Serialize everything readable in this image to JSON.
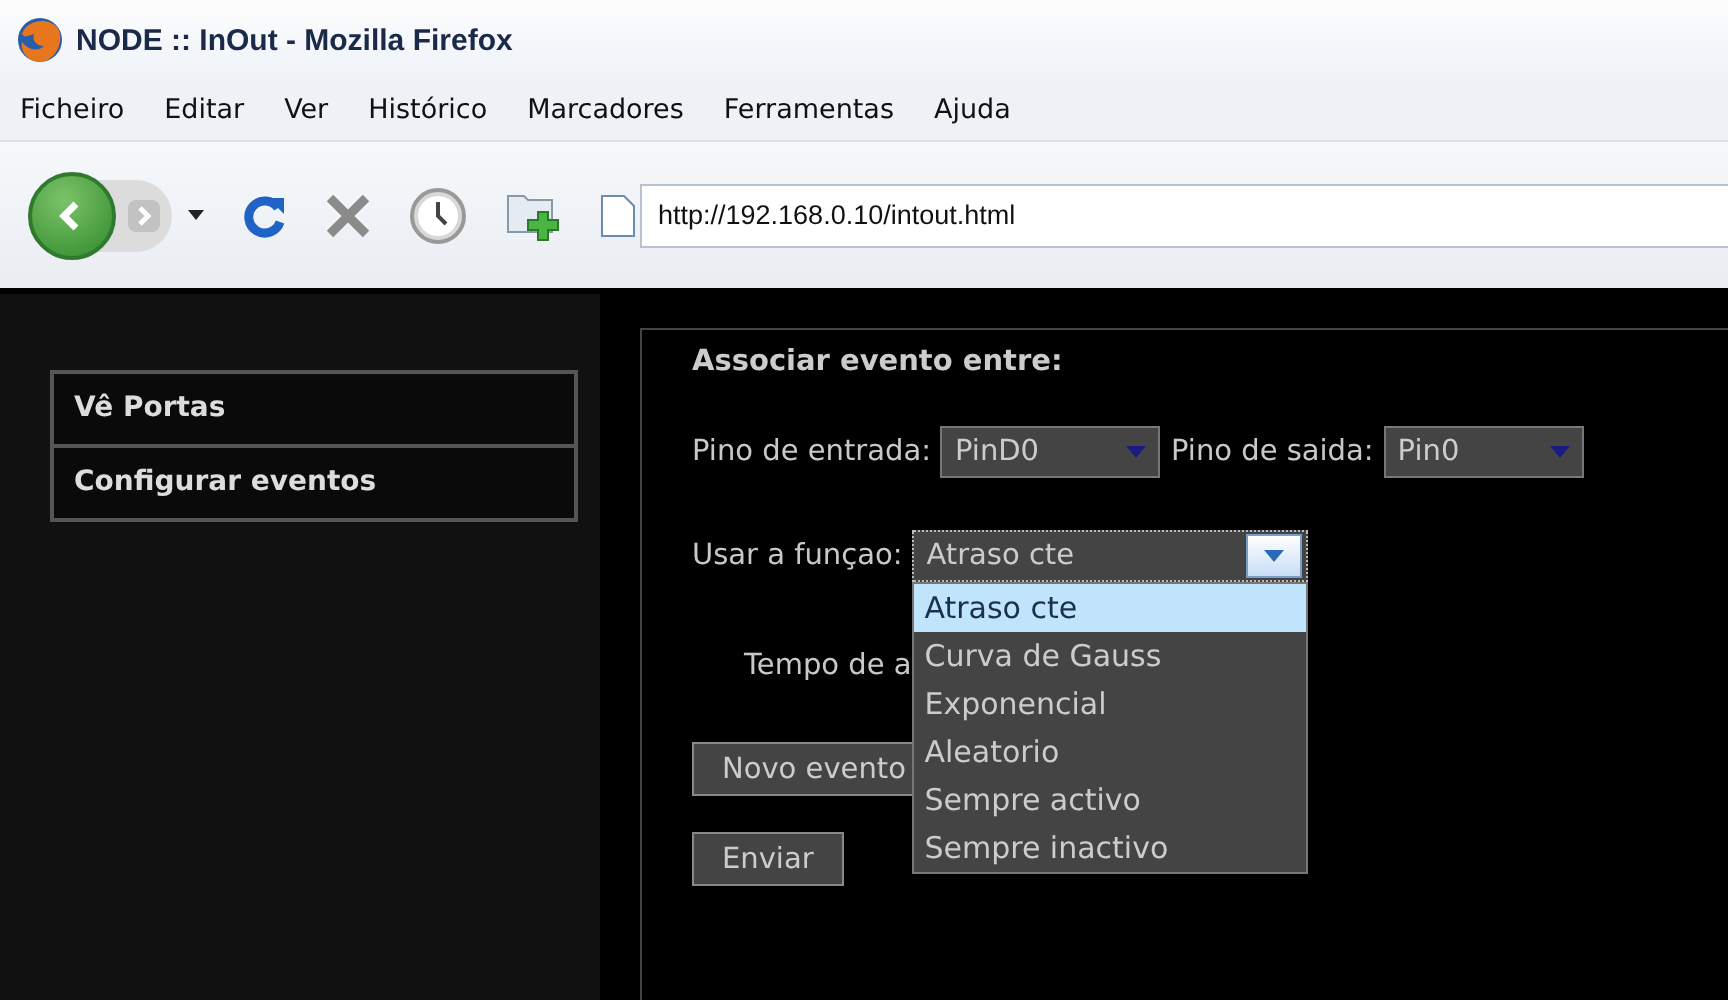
{
  "window": {
    "title": "NODE :: InOut - Mozilla Firefox"
  },
  "menu_bar": [
    "Ficheiro",
    "Editar",
    "Ver",
    "Histórico",
    "Marcadores",
    "Ferramentas",
    "Ajuda"
  ],
  "toolbar": {
    "address": "http://192.168.0.10/intout.html"
  },
  "sidebar": {
    "items": [
      "Vê Portas",
      "Configurar eventos"
    ]
  },
  "form": {
    "heading": "Associar evento entre:",
    "input_pin": {
      "label": "Pino de entrada:",
      "value": "PinD0"
    },
    "output_pin": {
      "label": "Pino de saida:",
      "value": "Pin0"
    },
    "function": {
      "label": "Usar a funçao:",
      "value": "Atraso cte",
      "expanded": true,
      "options": [
        {
          "label": "Atraso cte",
          "selected": true
        },
        {
          "label": "Curva de Gauss",
          "selected": false
        },
        {
          "label": "Exponencial",
          "selected": false
        },
        {
          "label": "Aleatorio",
          "selected": false
        },
        {
          "label": "Sempre activo",
          "selected": false
        },
        {
          "label": "Sempre inactivo",
          "selected": false
        }
      ]
    },
    "delay_label": "Tempo de a",
    "buttons": [
      "Novo evento",
      "Enviar"
    ]
  }
}
